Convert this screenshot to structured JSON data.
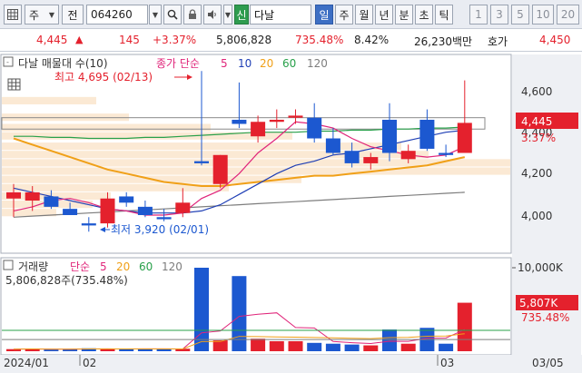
{
  "toolbar": {
    "icon_grid": "grid-icon",
    "period_label": "주",
    "prev_label": "전",
    "stock_code": "064260",
    "search_icon": "search-icon",
    "lock_icon": "lock-icon",
    "speaker_icon": "speaker-icon",
    "new_badge": "신",
    "stock_name": "다날",
    "tabs": [
      {
        "label": "일",
        "active": true
      },
      {
        "label": "주",
        "active": false
      },
      {
        "label": "월",
        "active": false
      },
      {
        "label": "년",
        "active": false
      },
      {
        "label": "분",
        "active": false
      },
      {
        "label": "초",
        "active": false
      },
      {
        "label": "틱",
        "active": false
      }
    ],
    "intervals": [
      "1",
      "3",
      "5",
      "10",
      "20"
    ]
  },
  "quote": {
    "price": "4,445",
    "up_arrow": "▲",
    "change": "145",
    "change_pct": "+3.37%",
    "volume": "5,806,828",
    "volume_ratio": "735.48%",
    "turnover": "8.42%",
    "amount": "26,230백만",
    "ask_label": "호가",
    "ask_price": "4,450"
  },
  "price_chart": {
    "legend_title": "다날 매물대 수(10)",
    "legend_ma_prefix": "종가 단순",
    "legend_ma": [
      {
        "label": "5",
        "color": "#e0257a"
      },
      {
        "label": "10",
        "color": "#1f3fb5"
      },
      {
        "label": "20",
        "color": "#f0a018"
      },
      {
        "label": "60",
        "color": "#28a04a"
      },
      {
        "label": "120",
        "color": "#7d7d7d"
      }
    ],
    "high_label": "최고 4,695 (02/13)",
    "low_label": "최저 3,920 (02/01)",
    "current_price": "4,445",
    "current_pct": "3.37%",
    "y_ticks": [
      "4,600",
      "4,400",
      "4,200",
      "4,000"
    ]
  },
  "volume_chart": {
    "legend_title": "거래량",
    "legend_ma_prefix": "단순",
    "legend_ma": [
      {
        "label": "5",
        "color": "#e0257a"
      },
      {
        "label": "20",
        "color": "#f0a018"
      },
      {
        "label": "60",
        "color": "#28a04a"
      },
      {
        "label": "120",
        "color": "#7d7d7d"
      }
    ],
    "current_volume_text": "5,806,828주(735.48%)",
    "y_top": "10,000K",
    "current_volume": "5,807K",
    "current_pct": "735.48%"
  },
  "x_axis": {
    "labels": [
      "2024/01",
      "02",
      "03",
      "03/05"
    ]
  },
  "chart_data": {
    "type": "candlestick",
    "candles": [
      {
        "o": 4080,
        "h": 4150,
        "l": 3990,
        "c": 4110
      },
      {
        "o": 4070,
        "h": 4140,
        "l": 4020,
        "c": 4110
      },
      {
        "o": 4090,
        "h": 4120,
        "l": 4030,
        "c": 4040
      },
      {
        "o": 4030,
        "h": 4060,
        "l": 4000,
        "c": 4000
      },
      {
        "o": 3960,
        "h": 3990,
        "l": 3920,
        "c": 3950
      },
      {
        "o": 3960,
        "h": 4110,
        "l": 3940,
        "c": 4080
      },
      {
        "o": 4090,
        "h": 4110,
        "l": 4040,
        "c": 4060
      },
      {
        "o": 4040,
        "h": 4070,
        "l": 3990,
        "c": 4000
      },
      {
        "o": 3990,
        "h": 4030,
        "l": 3970,
        "c": 3980
      },
      {
        "o": 4010,
        "h": 4130,
        "l": 3990,
        "c": 4060
      },
      {
        "o": 4260,
        "h": 4695,
        "l": 4240,
        "c": 4250
      },
      {
        "o": 4150,
        "h": 4290,
        "l": 4130,
        "c": 4290
      },
      {
        "o": 4460,
        "h": 4640,
        "l": 4420,
        "c": 4440
      },
      {
        "o": 4380,
        "h": 4480,
        "l": 4350,
        "c": 4450
      },
      {
        "o": 4450,
        "h": 4510,
        "l": 4420,
        "c": 4460
      },
      {
        "o": 4470,
        "h": 4510,
        "l": 4440,
        "c": 4480
      },
      {
        "o": 4470,
        "h": 4540,
        "l": 4350,
        "c": 4370
      },
      {
        "o": 4370,
        "h": 4420,
        "l": 4290,
        "c": 4300
      },
      {
        "o": 4310,
        "h": 4350,
        "l": 4230,
        "c": 4250
      },
      {
        "o": 4250,
        "h": 4300,
        "l": 4220,
        "c": 4280
      },
      {
        "o": 4460,
        "h": 4540,
        "l": 4260,
        "c": 4300
      },
      {
        "o": 4270,
        "h": 4340,
        "l": 4250,
        "c": 4310
      },
      {
        "o": 4460,
        "h": 4510,
        "l": 4310,
        "c": 4320
      },
      {
        "o": 4300,
        "h": 4340,
        "l": 4280,
        "c": 4290
      },
      {
        "o": 4300,
        "h": 4650,
        "l": 4300,
        "c": 4445
      }
    ],
    "volumes": [
      250,
      300,
      200,
      250,
      350,
      300,
      250,
      250,
      250,
      300,
      10000,
      1300,
      9000,
      1500,
      1200,
      1200,
      1000,
      900,
      800,
      700,
      2600,
      900,
      2800,
      900,
      5807
    ],
    "ma5": [
      4020,
      4040,
      4070,
      4080,
      4060,
      4030,
      4020,
      4000,
      4000,
      4010,
      4080,
      4120,
      4200,
      4300,
      4370,
      4450,
      4440,
      4420,
      4370,
      4330,
      4310,
      4290,
      4280,
      4290,
      4330
    ],
    "ma10": [
      4130,
      4110,
      4090,
      4070,
      4050,
      4030,
      4020,
      4010,
      4010,
      4010,
      4020,
      4050,
      4100,
      4150,
      4200,
      4240,
      4260,
      4290,
      4300,
      4320,
      4340,
      4360,
      4380,
      4400,
      4410
    ],
    "ma20": [
      4370,
      4340,
      4310,
      4280,
      4250,
      4220,
      4200,
      4180,
      4160,
      4150,
      4140,
      4140,
      4150,
      4160,
      4170,
      4180,
      4190,
      4190,
      4200,
      4210,
      4220,
      4230,
      4240,
      4260,
      4280
    ],
    "ma60": [
      4380,
      4380,
      4375,
      4375,
      4370,
      4370,
      4370,
      4375,
      4375,
      4380,
      4385,
      4390,
      4395,
      4400,
      4400,
      4400,
      4405,
      4405,
      4410,
      4410,
      4415,
      4415,
      4420,
      4420,
      4425
    ],
    "ma120": [
      3990,
      3995,
      4000,
      4005,
      4010,
      4015,
      4020,
      4025,
      4030,
      4035,
      4040,
      4045,
      4050,
      4055,
      4060,
      4065,
      4070,
      4075,
      4080,
      4085,
      4090,
      4095,
      4100,
      4105,
      4110
    ],
    "price_range": [
      3860,
      4730
    ],
    "volume_range": [
      0,
      11000
    ],
    "colors": {
      "up": "#e4212d",
      "down": "#1c58d0",
      "volume_profile": "#fbe9d4"
    }
  }
}
